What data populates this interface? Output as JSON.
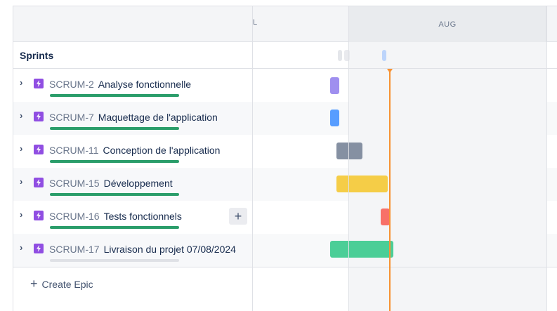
{
  "header": {
    "sprints_label": "Sprints",
    "months": [
      "L",
      "AUG"
    ]
  },
  "epics": [
    {
      "key": "SCRUM-2",
      "summary": "Analyse fonctionnelle",
      "progress_pct": 100,
      "bar_color": "#9f8fef"
    },
    {
      "key": "SCRUM-7",
      "summary": "Maquettage de l'application",
      "progress_pct": 100,
      "bar_color": "#579dff"
    },
    {
      "key": "SCRUM-11",
      "summary": "Conception de l'application",
      "progress_pct": 100,
      "bar_color": "#8590a2"
    },
    {
      "key": "SCRUM-15",
      "summary": "Développement",
      "progress_pct": 100,
      "bar_color": "#f5cd47"
    },
    {
      "key": "SCRUM-16",
      "summary": "Tests fonctionnels",
      "progress_pct": 100,
      "bar_color": "#f87168"
    },
    {
      "key": "SCRUM-17",
      "summary": "Livraison du projet 07/08/2024",
      "progress_pct": 0,
      "bar_color": "#4bce97"
    }
  ],
  "row_actions": {
    "add_child_label": "+"
  },
  "create_epic": {
    "label": "Create Epic",
    "icon": "+"
  },
  "colors": {
    "epic_icon": "#904ee2",
    "progress_done": "#2a9d6a",
    "today_marker": "#f79233"
  }
}
